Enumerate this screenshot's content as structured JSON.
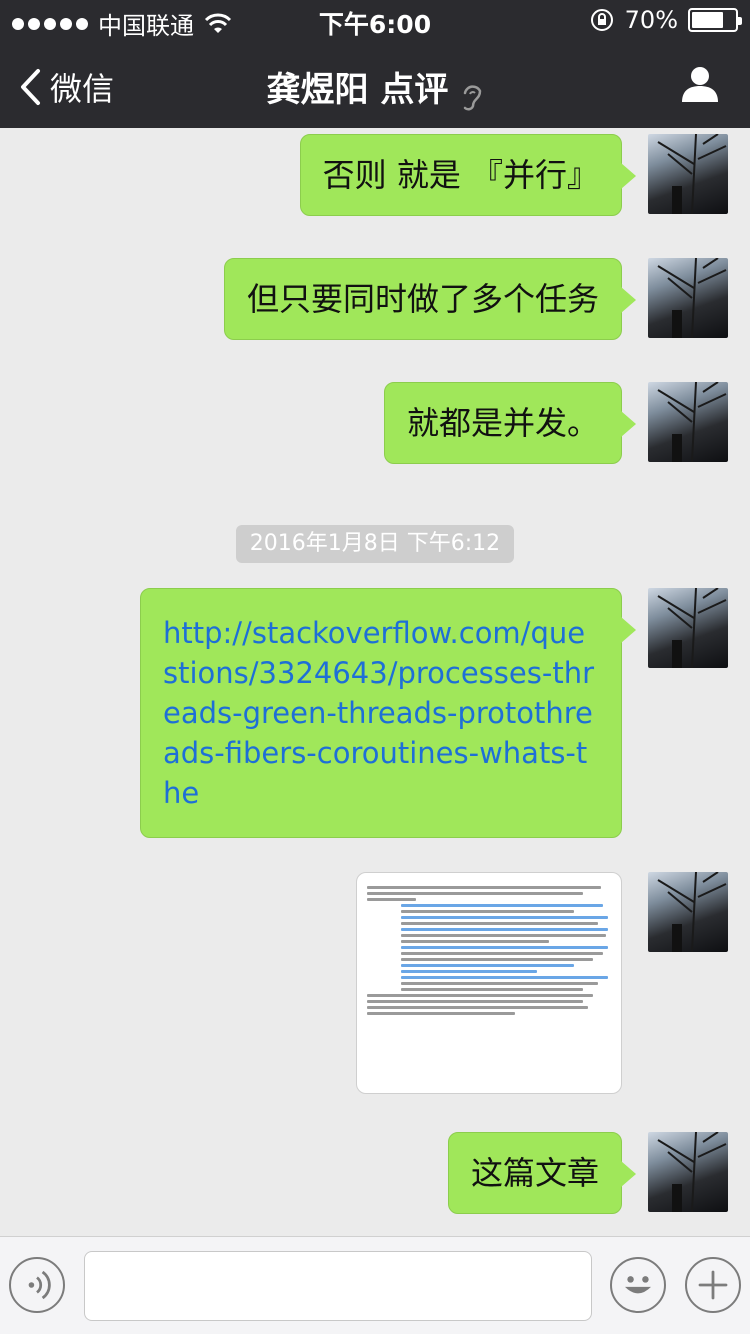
{
  "status_bar": {
    "carrier": "中国联通",
    "time": "下午6:00",
    "battery": "70%",
    "battery_level": 0.7
  },
  "nav": {
    "back_label": "微信",
    "title": "龚煜阳 点评",
    "icons": [
      "chevron-left-icon",
      "ear-icon",
      "person-icon"
    ]
  },
  "messages": [
    {
      "type": "text",
      "text": "否则 就是 『并行』"
    },
    {
      "type": "text",
      "text": "但只要同时做了多个任务"
    },
    {
      "type": "text",
      "text": "就都是并发。"
    },
    {
      "type": "timestamp",
      "text": "2016年1月8日 下午6:12"
    },
    {
      "type": "link",
      "text": "http://stackoverflow.com/questions/3324643/processes-threads-green-threads-protothreads-fibers-coroutines-whats-the"
    },
    {
      "type": "image",
      "text": "screenshot of a stackoverflow answer"
    },
    {
      "type": "text",
      "text": "这篇文章"
    }
  ],
  "input_bar": {
    "placeholder": "",
    "icons": [
      "voice-icon",
      "emoji-icon",
      "plus-icon"
    ]
  },
  "colors": {
    "header_bg": "#2b2b2f",
    "chat_bg": "#ebebeb",
    "bubble": "#a0e75a",
    "link": "#1e6fd7"
  }
}
